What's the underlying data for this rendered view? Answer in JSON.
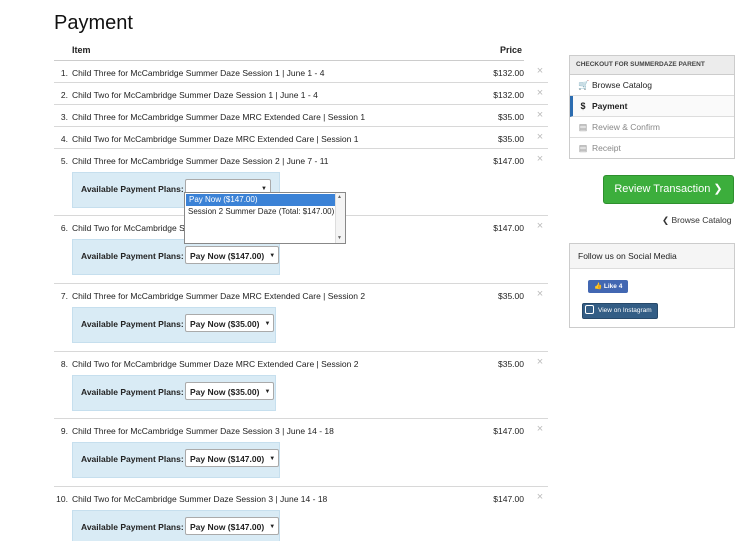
{
  "page_title": "Payment",
  "table": {
    "item_header": "Item",
    "price_header": "Price",
    "plan_label": "Available Payment Plans:",
    "remove_icon": "×",
    "rows": [
      {
        "num": "1.",
        "name": "Child Three for McCambridge Summer Daze Session 1 | June 1 - 4",
        "price": "$132.00",
        "plan": ""
      },
      {
        "num": "2.",
        "name": "Child Two for McCambridge Summer Daze Session 1 | June 1 - 4",
        "price": "$132.00",
        "plan": ""
      },
      {
        "num": "3.",
        "name": "Child Three for McCambridge Summer Daze MRC Extended Care | Session 1",
        "price": "$35.00",
        "plan": ""
      },
      {
        "num": "4.",
        "name": "Child Two for McCambridge Summer Daze MRC Extended Care | Session 1",
        "price": "$35.00",
        "plan": ""
      },
      {
        "num": "5.",
        "name": "Child Three for McCambridge Summer Daze Session 2 | June 7 - 11",
        "price": "$147.00",
        "plan": ""
      },
      {
        "num": "6.",
        "name": "Child Two for McCambridge S",
        "price": "$147.00",
        "plan": "Pay Now ($147.00)"
      },
      {
        "num": "7.",
        "name": "Child Three for McCambridge Summer Daze MRC Extended Care | Session 2",
        "price": "$35.00",
        "plan": "Pay Now ($35.00)"
      },
      {
        "num": "8.",
        "name": "Child Two for McCambridge Summer Daze MRC Extended Care | Session 2",
        "price": "$35.00",
        "plan": "Pay Now ($35.00)"
      },
      {
        "num": "9.",
        "name": "Child Three for McCambridge Summer Daze Session 3 | June 14 - 18",
        "price": "$147.00",
        "plan": "Pay Now ($147.00)"
      },
      {
        "num": "10.",
        "name": "Child Two for McCambridge Summer Daze Session 3 | June 14 - 18",
        "price": "$147.00",
        "plan": "Pay Now ($147.00)"
      }
    ]
  },
  "dropdown": {
    "options": [
      "Pay Now ($147.00)",
      "Session 2 Summer Daze (Total: $147.00)"
    ],
    "selected_index": 0
  },
  "checkout": {
    "header": "CHECKOUT FOR SUMMERDAZE PARENT",
    "steps": [
      {
        "label": "Browse Catalog",
        "icon": "cart-icon",
        "glyph": "🛒",
        "state": "done"
      },
      {
        "label": "Payment",
        "icon": "dollar-icon",
        "glyph": "$",
        "state": "active"
      },
      {
        "label": "Review & Confirm",
        "icon": "review-icon",
        "glyph": "▤",
        "state": "disabled"
      },
      {
        "label": "Receipt",
        "icon": "receipt-icon",
        "glyph": "▤",
        "state": "disabled"
      }
    ]
  },
  "review_button": {
    "label": "Review Transaction",
    "arrow": "❯"
  },
  "back_link": {
    "label": "Browse Catalog",
    "arrow": "❮"
  },
  "social": {
    "header": "Follow us on Social Media",
    "fb_label": "Like 4",
    "ig_label": "View on Instagram"
  },
  "colors": {
    "accent_green": "#3cae3c",
    "plan_bg": "#d9ebf5",
    "active_step": "#2b6cb0",
    "select_highlight": "#3b82d6"
  }
}
